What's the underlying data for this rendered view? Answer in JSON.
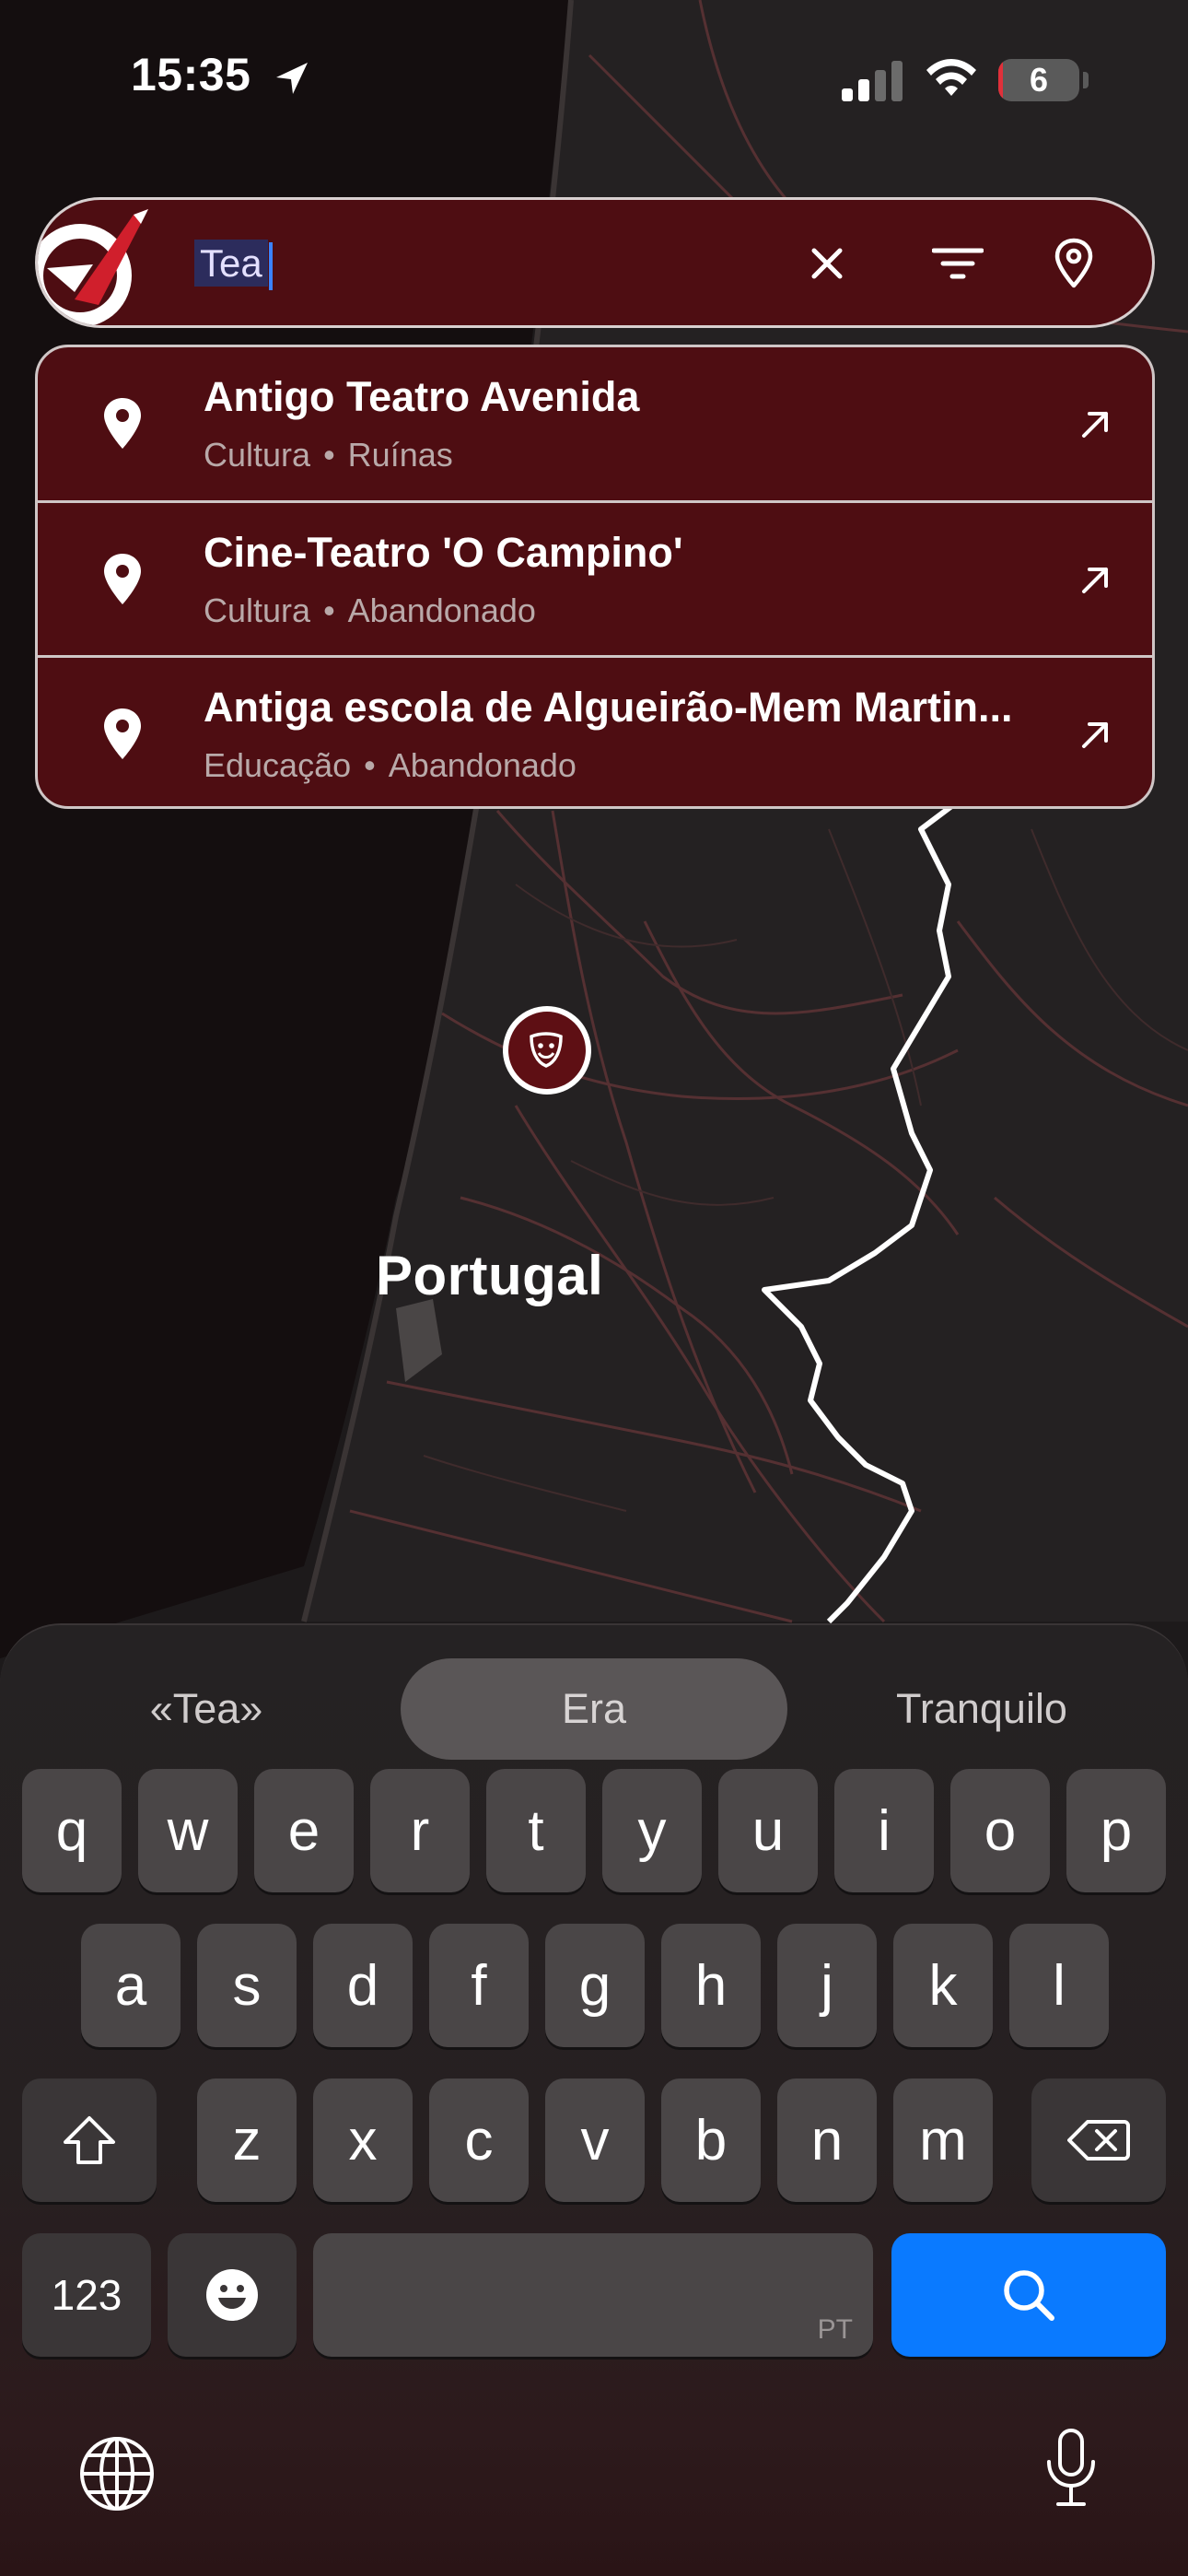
{
  "status_bar": {
    "time": "15:35",
    "battery_level": "6",
    "battery_fraction": 0.06
  },
  "search": {
    "value": "Tea",
    "clear_icon": "close-icon",
    "filter_icon": "filter-icon",
    "location_icon": "location-pin-icon"
  },
  "suggestions": [
    {
      "title": "Antigo Teatro Avenida",
      "category": "Cultura",
      "status": "Ruínas"
    },
    {
      "title": "Cine-Teatro 'O Campino'",
      "category": "Cultura",
      "status": "Abandonado"
    },
    {
      "title": "Antiga escola de Algueirão-Mem Martin...",
      "category": "Educação",
      "status": "Abandonado"
    }
  ],
  "map": {
    "country_label": "Portugal",
    "marker_icon": "theatre-masks-icon"
  },
  "keyboard": {
    "predictions": [
      "«Tea»",
      "Era",
      "Tranquilo"
    ],
    "row1": [
      "q",
      "w",
      "e",
      "r",
      "t",
      "y",
      "u",
      "i",
      "o",
      "p"
    ],
    "row2": [
      "a",
      "s",
      "d",
      "f",
      "g",
      "h",
      "j",
      "k",
      "l"
    ],
    "row3": [
      "z",
      "x",
      "c",
      "v",
      "b",
      "n",
      "m"
    ],
    "numbers_key": "123",
    "space_language": "PT",
    "search_key_icon": "search-icon",
    "colors": {
      "search_key": "#0a7aff"
    }
  },
  "colors": {
    "accent": "#4e0d12",
    "border": "#d8d0d0"
  }
}
